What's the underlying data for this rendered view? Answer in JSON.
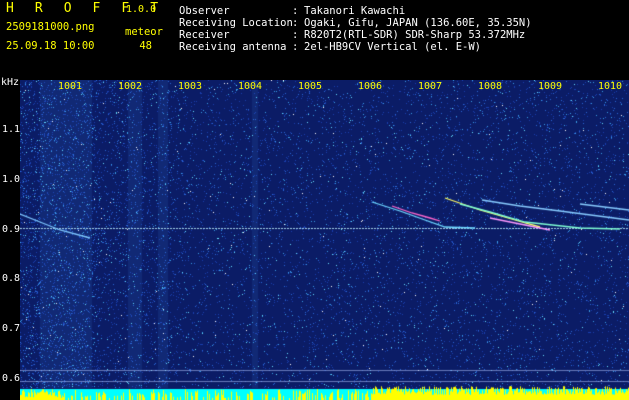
{
  "header": {
    "app_name": "H R O F F T",
    "version": "1.0.0",
    "filename": "2509181000.png",
    "datetime": "25.09.18 10:00",
    "meteor_label": "meteor",
    "meteor_count": "48",
    "info": [
      {
        "key": "Observer",
        "value": "Takanori Kawachi"
      },
      {
        "key": "Receiving Location",
        "value": "Ogaki, Gifu, JAPAN (136.60E, 35.35N)"
      },
      {
        "key": "Receiver",
        "value": "R820T2(RTL-SDR) SDR-Sharp 53.372MHz"
      },
      {
        "key": "Receiving antenna",
        "value": "2el-HB9CV Vertical (el. E-W)"
      }
    ]
  },
  "axes": {
    "y_unit": "kHz",
    "y_ticks": [
      "1.1",
      "1.0",
      "0.9",
      "0.8",
      "0.7",
      "0.6"
    ],
    "x_ticks": [
      "1001",
      "1002",
      "1003",
      "1004",
      "1005",
      "1006",
      "1007",
      "1008",
      "1009",
      "1010"
    ]
  },
  "colors": {
    "header_text": "#ffff00",
    "background": "#0b1c66",
    "signal": "#ffff00",
    "noise": "#00ffff"
  }
}
